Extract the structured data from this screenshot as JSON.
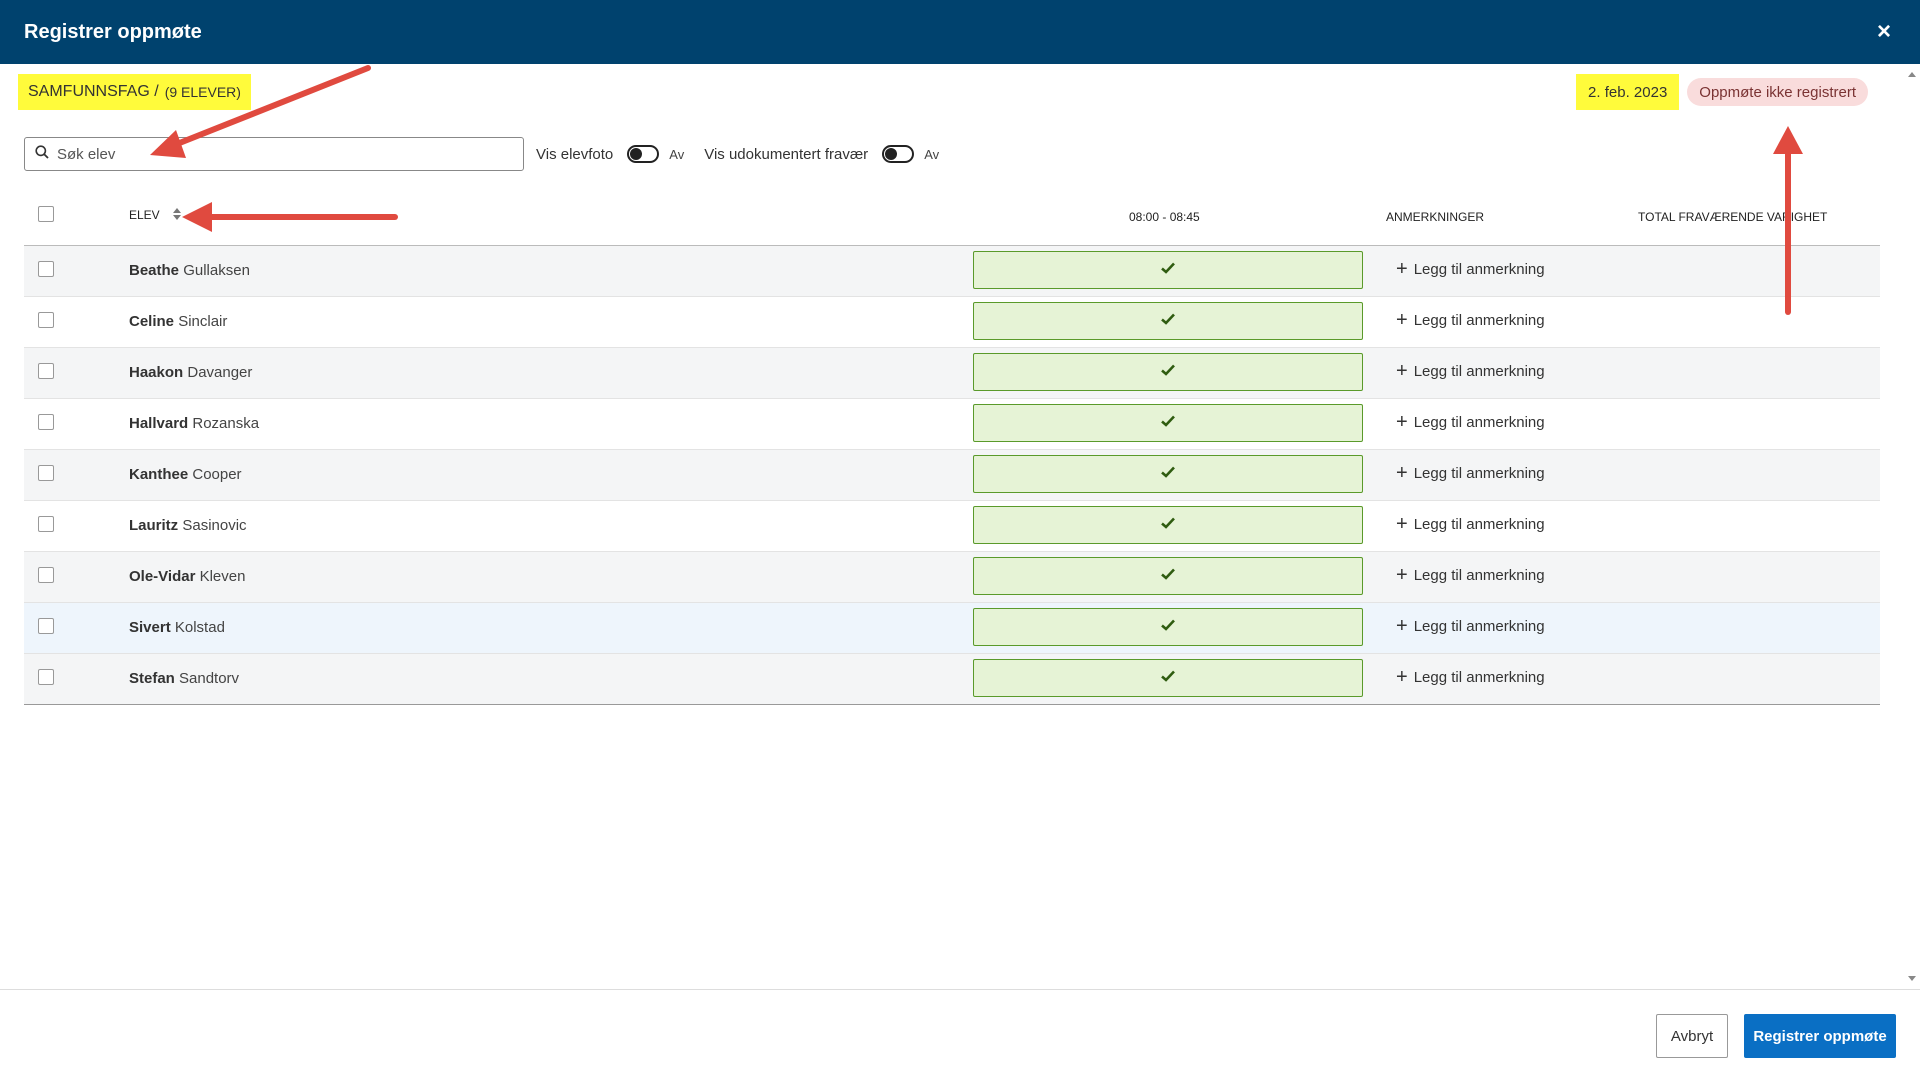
{
  "window": {
    "title": "Registrer oppmøte",
    "close_label": "×"
  },
  "subject": {
    "name": "SAMFUNNSFAG /",
    "count": "(9 ELEVER)"
  },
  "date": "2. feb. 2023",
  "status": "Oppmøte ikke registrert",
  "search": {
    "placeholder": "Søk elev",
    "icon": "search-icon"
  },
  "toggles": [
    {
      "label": "Vis elevfoto",
      "state": "Av"
    },
    {
      "label": "Vis udokumentert fravær",
      "state": "Av"
    }
  ],
  "table": {
    "headers": {
      "student": "ELEV",
      "period": "08:00 - 08:45",
      "notes": "ANMERKNINGER",
      "absence": "TOTAL FRAVÆRENDE VARIGHET"
    },
    "add_note_label": "Legg til anmerkning",
    "rows": [
      {
        "first": "Beathe",
        "last": "Gullaksen",
        "present": true
      },
      {
        "first": "Celine",
        "last": "Sinclair",
        "present": true
      },
      {
        "first": "Haakon",
        "last": "Davanger",
        "present": true
      },
      {
        "first": "Hallvard",
        "last": "Rozanska",
        "present": true
      },
      {
        "first": "Kanthee",
        "last": "Cooper",
        "present": true
      },
      {
        "first": "Lauritz",
        "last": "Sasinovic",
        "present": true
      },
      {
        "first": "Ole-Vidar",
        "last": "Kleven",
        "present": true
      },
      {
        "first": "Sivert",
        "last": "Kolstad",
        "present": true
      },
      {
        "first": "Stefan",
        "last": "Sandtorv",
        "present": true
      }
    ]
  },
  "footer": {
    "cancel_label": "Avbryt",
    "submit_label": "Registrer oppmøte"
  },
  "colors": {
    "header_bg": "#00426e",
    "highlight": "#fffb3b",
    "present_bg": "#e6f3d6",
    "present_border": "#5a9a2a",
    "primary": "#0a6fc4",
    "annotation_arrow": "#e04a3f"
  }
}
